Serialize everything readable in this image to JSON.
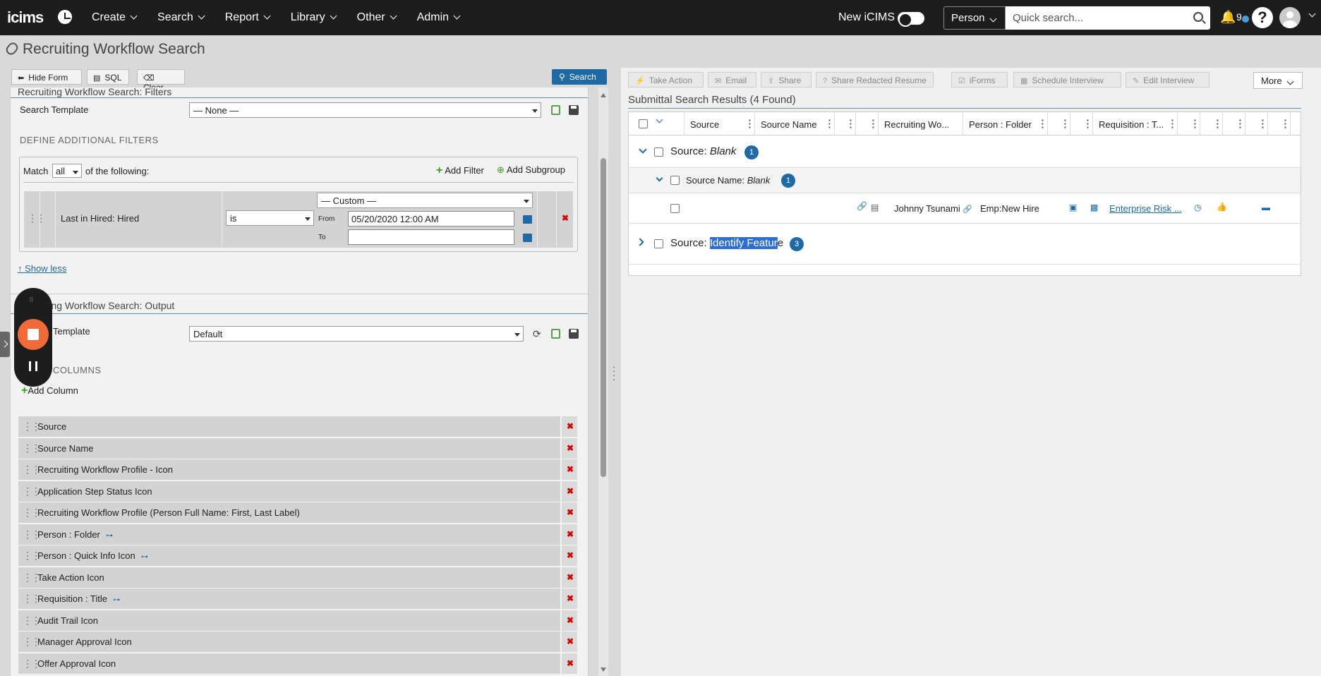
{
  "nav": {
    "logo": "icims",
    "menu": [
      "Create",
      "Search",
      "Report",
      "Library",
      "Other",
      "Admin"
    ],
    "new_icims_label": "New iCIMS",
    "person_select": "Person",
    "quick_search_placeholder": "Quick search...",
    "notification_count": "9"
  },
  "page": {
    "title": "Recruiting Workflow Search"
  },
  "left_toolbar": {
    "hide_form": "Hide Form",
    "sql": "SQL",
    "clear": "Clear",
    "search": "Search"
  },
  "filters": {
    "section_title": "Recruiting Workflow Search: Filters",
    "search_template_label": "Search Template",
    "search_template_value": "— None —",
    "define_label": "DEFINE ADDITIONAL FILTERS",
    "match_prefix": "Match",
    "match_value": "all",
    "match_suffix": "of the following:",
    "add_filter": "Add Filter",
    "add_subgroup": "Add Subgroup",
    "row": {
      "field": "Last in Hired: Hired",
      "operator": "is",
      "range": "— Custom —",
      "from_label": "From",
      "from_value": "05/20/2020 12:00 AM",
      "to_label": "To",
      "to_value": ""
    },
    "show_less": "↑ Show less"
  },
  "output": {
    "section_title": "Recruiting Workflow Search: Output",
    "template_label": "Template",
    "template_value": "Default",
    "columns_label": "COLUMNS",
    "add_column": "Add Column",
    "columns": [
      {
        "name": "Source",
        "tree": false
      },
      {
        "name": "Source Name",
        "tree": false
      },
      {
        "name": "Recruiting Workflow Profile - Icon",
        "tree": false
      },
      {
        "name": "Application Step Status Icon",
        "tree": false
      },
      {
        "name": "Recruiting Workflow Profile (Person Full Name: First, Last Label)",
        "tree": false
      },
      {
        "name": "Person : Folder",
        "tree": true
      },
      {
        "name": "Person : Quick Info Icon",
        "tree": true
      },
      {
        "name": "Take Action Icon",
        "tree": false
      },
      {
        "name": "Requisition : Title",
        "tree": true
      },
      {
        "name": "Audit Trail Icon",
        "tree": false
      },
      {
        "name": "Manager Approval Icon",
        "tree": false
      },
      {
        "name": "Offer Approval Icon",
        "tree": false
      }
    ]
  },
  "right_toolbar": {
    "take_action": "Take Action",
    "email": "Email",
    "share": "Share",
    "share_redacted": "Share Redacted Resume",
    "iforms": "iForms",
    "schedule_interview": "Schedule Interview",
    "edit_interview": "Edit Interview",
    "more": "More"
  },
  "results": {
    "title": "Submittal Search Results (4 Found)",
    "headers": [
      "Source",
      "Source Name",
      "Recruiting Wo...",
      "Person : Folder",
      "Requisition : T..."
    ],
    "group1": {
      "prefix": "Source:",
      "value": "Blank",
      "count": "1"
    },
    "subgroup1": {
      "prefix": "Source Name:",
      "value": "Blank",
      "count": "1"
    },
    "row1": {
      "name": "Johnny Tsunami",
      "folder": "Emp:New Hire",
      "requisition": "Enterprise Risk ..."
    },
    "group2": {
      "prefix": "Source:",
      "value_highlight": "Identify Featur",
      "value_rest": "e",
      "count": "3"
    }
  },
  "colors": {
    "nav_bg": "#1d1d1d",
    "accent": "#1f6aa5",
    "record_stop": "#f06a3a",
    "remove_red": "#cc0000"
  }
}
